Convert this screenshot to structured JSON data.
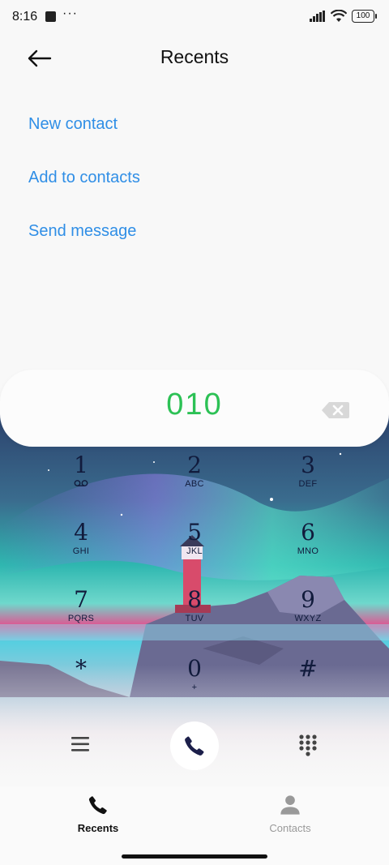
{
  "status": {
    "time": "8:16",
    "dots": "···",
    "battery": "100"
  },
  "header": {
    "title": "Recents",
    "back_icon": "back-arrow-icon"
  },
  "actions": [
    {
      "label": "New contact"
    },
    {
      "label": "Add to contacts"
    },
    {
      "label": "Send message"
    }
  ],
  "dialer": {
    "number": "010",
    "number_color": "#2cc155",
    "backspace_icon": "backspace-icon"
  },
  "keypad": [
    {
      "digit": "1",
      "letters": ""
    },
    {
      "digit": "2",
      "letters": "ABC"
    },
    {
      "digit": "3",
      "letters": "DEF"
    },
    {
      "digit": "4",
      "letters": "GHI"
    },
    {
      "digit": "5",
      "letters": "JKL"
    },
    {
      "digit": "6",
      "letters": "MNO"
    },
    {
      "digit": "7",
      "letters": "PQRS"
    },
    {
      "digit": "8",
      "letters": "TUV"
    },
    {
      "digit": "9",
      "letters": "WXYZ"
    },
    {
      "digit": "*",
      "letters": ""
    },
    {
      "digit": "0",
      "letters": "+"
    },
    {
      "digit": "#",
      "letters": ""
    }
  ],
  "bottom_actions": {
    "menu_icon": "menu-icon",
    "call_icon": "phone-icon",
    "dialpad_icon": "dialpad-icon"
  },
  "tabs": [
    {
      "label": "Recents",
      "active": true,
      "icon": "phone-icon"
    },
    {
      "label": "Contacts",
      "active": false,
      "icon": "person-icon"
    }
  ],
  "colors": {
    "accent_link": "#2f8ee6",
    "number": "#2cc155",
    "key_text": "#111b3c"
  }
}
